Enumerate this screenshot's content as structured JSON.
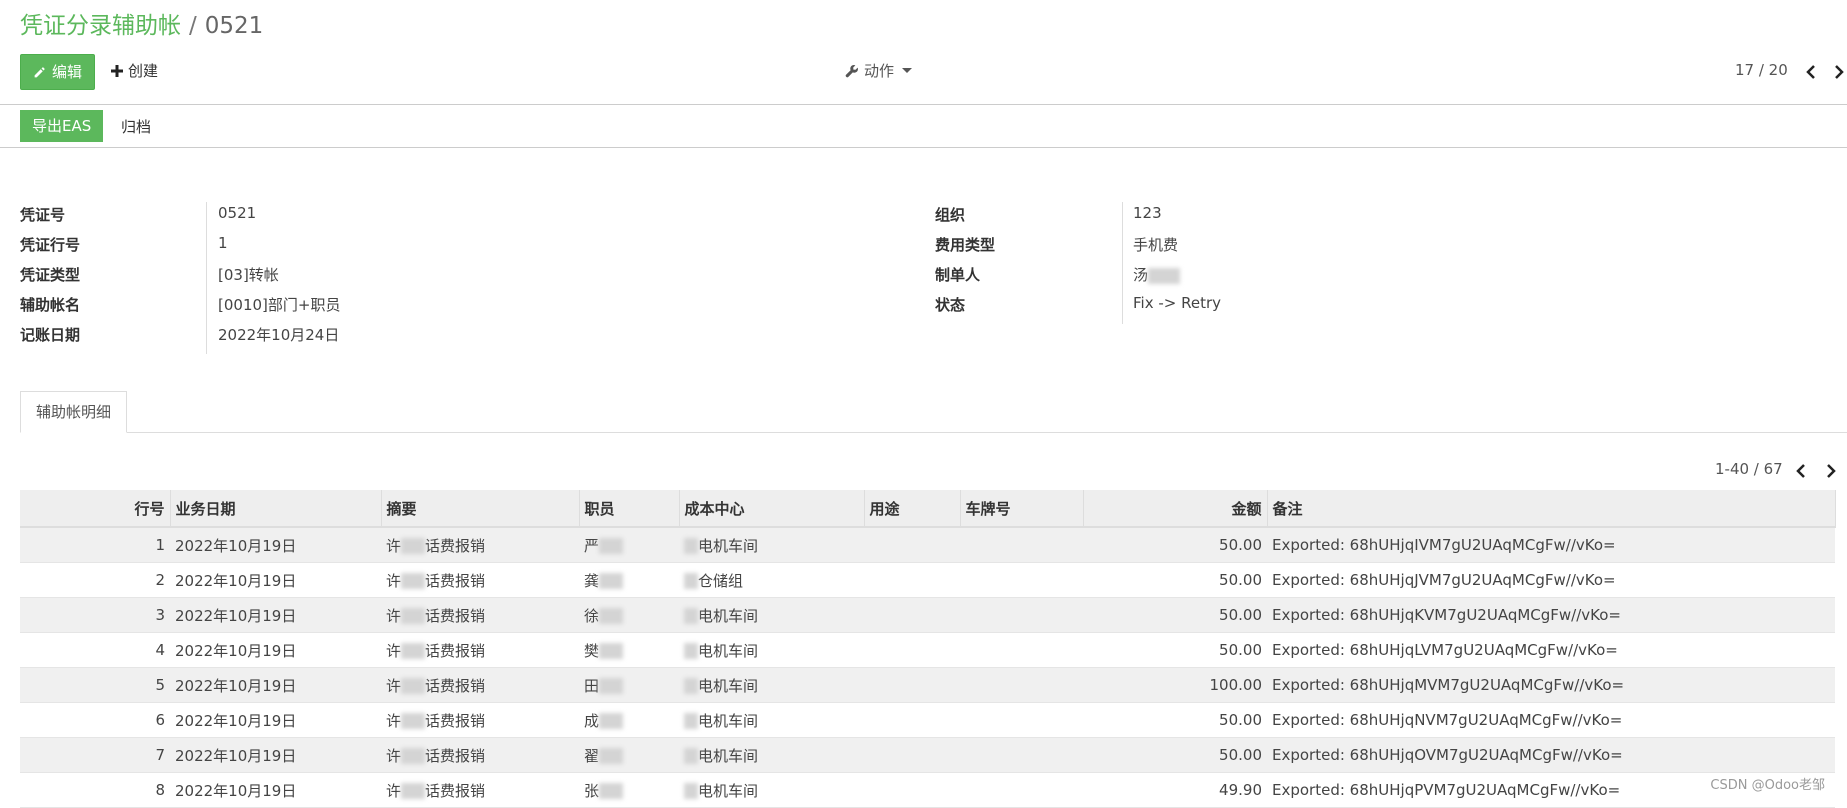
{
  "breadcrumb": {
    "parent": "凭证分录辅助帐",
    "separator": "/",
    "current": "0521"
  },
  "toolbar": {
    "edit_label": "编辑",
    "create_label": "创建",
    "action_label": "动作",
    "pager": "17 / 20"
  },
  "statusbar": {
    "export_label": "导出EAS",
    "archive_label": "归档"
  },
  "form": {
    "left": [
      {
        "label": "凭证号",
        "value": "0521"
      },
      {
        "label": "凭证行号",
        "value": "1"
      },
      {
        "label": "凭证类型",
        "value": "[03]转帐"
      },
      {
        "label": "辅助帐名",
        "value": "[0010]部门+职员"
      },
      {
        "label": "记账日期",
        "value": "2022年10月24日"
      }
    ],
    "right": [
      {
        "label": "组织",
        "value": "123"
      },
      {
        "label": "费用类型",
        "value": "手机费"
      },
      {
        "label": "制单人",
        "value": "汤"
      },
      {
        "label": "状态",
        "value": "Fix -> Retry"
      }
    ]
  },
  "tabs": [
    {
      "label": "辅助帐明细"
    }
  ],
  "list": {
    "pager": "1-40 / 67",
    "columns": [
      "行号",
      "业务日期",
      "摘要",
      "职员",
      "成本中心",
      "用途",
      "车牌号",
      "金额",
      "备注"
    ],
    "rows": [
      {
        "no": "1",
        "date": "2022年10月19日",
        "summary_pre": "许",
        "summary_post": "话费报销",
        "staff": "严",
        "cost_post": "电机车间",
        "amount": "50.00",
        "note": "Exported: 68hUHjqIVM7gU2UAqMCgFw//vKo="
      },
      {
        "no": "2",
        "date": "2022年10月19日",
        "summary_pre": "许",
        "summary_post": "话费报销",
        "staff": "龚",
        "cost_post": "仓储组",
        "amount": "50.00",
        "note": "Exported: 68hUHjqJVM7gU2UAqMCgFw//vKo="
      },
      {
        "no": "3",
        "date": "2022年10月19日",
        "summary_pre": "许",
        "summary_post": "话费报销",
        "staff": "徐",
        "cost_post": "电机车间",
        "amount": "50.00",
        "note": "Exported: 68hUHjqKVM7gU2UAqMCgFw//vKo="
      },
      {
        "no": "4",
        "date": "2022年10月19日",
        "summary_pre": "许",
        "summary_post": "话费报销",
        "staff": "樊",
        "cost_post": "电机车间",
        "amount": "50.00",
        "note": "Exported: 68hUHjqLVM7gU2UAqMCgFw//vKo="
      },
      {
        "no": "5",
        "date": "2022年10月19日",
        "summary_pre": "许",
        "summary_post": "话费报销",
        "staff": "田",
        "cost_post": "电机车间",
        "amount": "100.00",
        "note": "Exported: 68hUHjqMVM7gU2UAqMCgFw//vKo="
      },
      {
        "no": "6",
        "date": "2022年10月19日",
        "summary_pre": "许",
        "summary_post": "话费报销",
        "staff": "成",
        "cost_post": "电机车间",
        "amount": "50.00",
        "note": "Exported: 68hUHjqNVM7gU2UAqMCgFw//vKo="
      },
      {
        "no": "7",
        "date": "2022年10月19日",
        "summary_pre": "许",
        "summary_post": "话费报销",
        "staff": "翟",
        "cost_post": "电机车间",
        "amount": "50.00",
        "note": "Exported: 68hUHjqOVM7gU2UAqMCgFw//vKo="
      },
      {
        "no": "8",
        "date": "2022年10月19日",
        "summary_pre": "许",
        "summary_post": "话费报销",
        "staff": "张",
        "cost_post": "电机车间",
        "amount": "49.90",
        "note": "Exported: 68hUHjqPVM7gU2UAqMCgFw//vKo="
      }
    ]
  },
  "watermark": "CSDN @Odoo老邹",
  "colors": {
    "primary": "#5cb85c",
    "row_stripe": "#f0f0f0",
    "header_bg": "#eeeeee"
  },
  "icons": {
    "edit": "pencil-icon",
    "create": "plus-icon",
    "action": "wrench-icon",
    "prev": "chevron-left-icon",
    "next": "chevron-right-icon"
  }
}
